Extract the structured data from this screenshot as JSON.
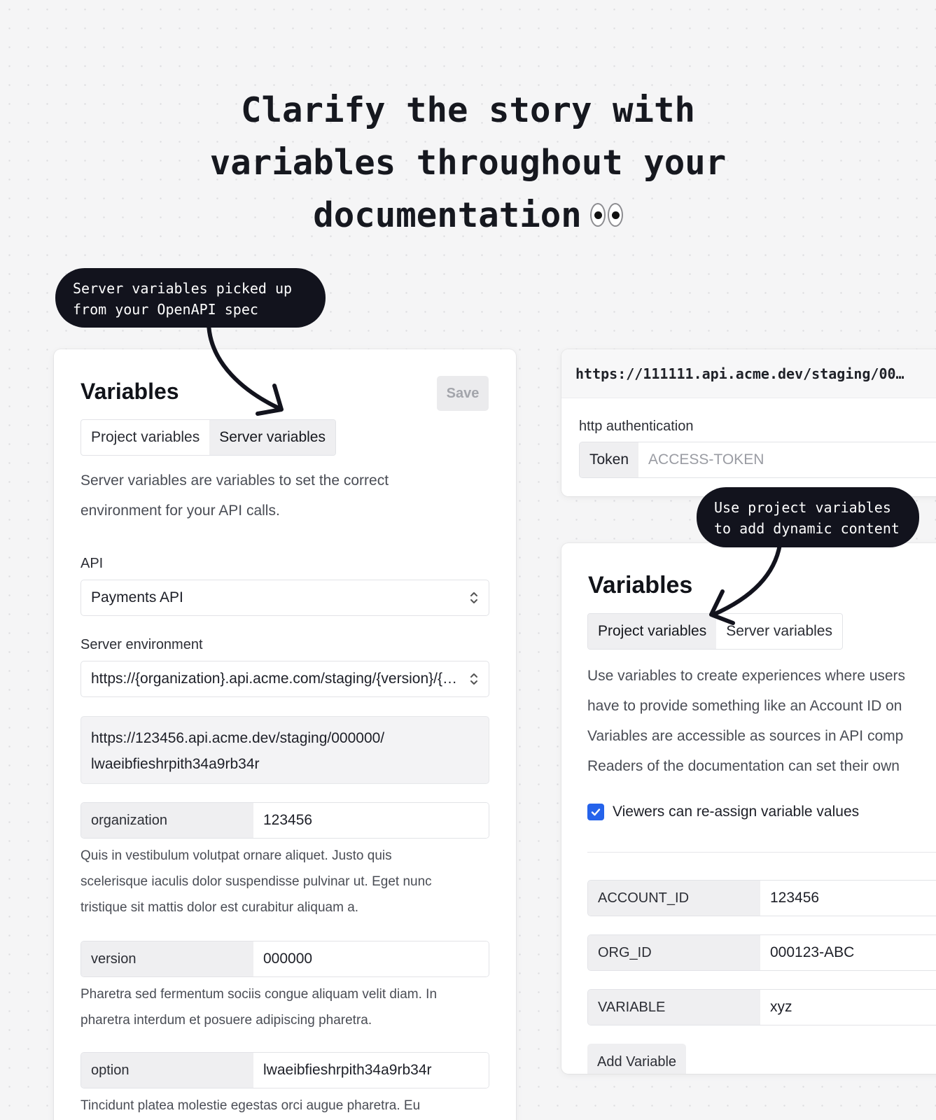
{
  "hero": {
    "line1": "Clarify the story with",
    "line2": "variables throughout your",
    "line3": "documentation"
  },
  "callout_left": {
    "line1": "Server variables picked up",
    "line2": "from your OpenAPI spec"
  },
  "callout_right": {
    "line1": "Use project variables",
    "line2": "to add dynamic content"
  },
  "left_panel": {
    "title": "Variables",
    "save_label": "Save",
    "tabs": [
      {
        "label": "Project variables",
        "active": false
      },
      {
        "label": "Server variables",
        "active": true
      }
    ],
    "description_1": "Server variables are variables to set the correct",
    "description_2": "environment for your API calls.",
    "api_label": "API",
    "api_value": "Payments API",
    "server_env_label": "Server environment",
    "server_env_value": "https://{organization}.api.acme.com/staging/{version}/{option}",
    "resolved_url_1": "https://123456.api.acme.dev/staging/000000/",
    "resolved_url_2": "lwaeibfieshrpith34a9rb34r",
    "variables": [
      {
        "key": "organization",
        "value": "123456",
        "help_1": "Quis in vestibulum volutpat ornare aliquet. Justo quis",
        "help_2": "scelerisque iaculis dolor suspendisse pulvinar ut. Eget nunc",
        "help_3": "tristique sit mattis dolor est curabitur aliquam a."
      },
      {
        "key": "version",
        "value": "000000",
        "help_1": "Pharetra sed fermentum sociis congue aliquam velit diam. In",
        "help_2": "pharetra interdum et posuere adipiscing pharetra."
      },
      {
        "key": "option",
        "value": "lwaeibfieshrpith34a9rb34r",
        "help_1": "Tincidunt platea molestie egestas orci augue pharetra. Eu"
      }
    ]
  },
  "right_top_panel": {
    "url": "https://111111.api.acme.dev/staging/00…",
    "auth_label": "http authentication",
    "token_key": "Token",
    "token_value": "ACCESS-TOKEN"
  },
  "right_bottom_panel": {
    "title": "Variables",
    "tabs": [
      {
        "label": "Project variables",
        "active": true
      },
      {
        "label": "Server variables",
        "active": false
      }
    ],
    "description": [
      "Use variables to create experiences where users",
      "have to provide something like an Account ID on",
      "Variables are accessible as sources in API comp",
      "Readers of the documentation can set their own"
    ],
    "checkbox_label": "Viewers can re-assign variable values",
    "checkbox_checked": true,
    "variables": [
      {
        "key": "ACCOUNT_ID",
        "value": "123456"
      },
      {
        "key": "ORG_ID",
        "value": "000123-ABC"
      },
      {
        "key": "VARIABLE",
        "value": "xyz"
      }
    ],
    "add_label": "Add Variable"
  },
  "colors": {
    "accent": "#2563eb",
    "callout_bg": "#12131d",
    "tab_active_bg": "#efeff1"
  }
}
